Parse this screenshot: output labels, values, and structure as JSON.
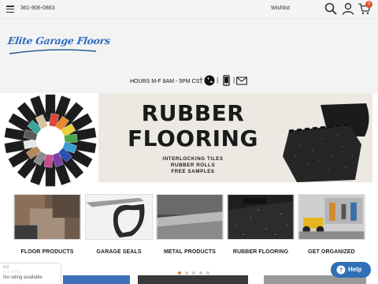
{
  "topbar": {
    "phone": "361-906-0863",
    "wishlist": "Wishlist",
    "cart_count": "0"
  },
  "header": {
    "logo_text": "Elite Garage Floors",
    "hours": "HOURS M-F 8AM - 5PM CST",
    "separator": "|"
  },
  "hero": {
    "title_line1": "RUBBER",
    "title_line2": "FLOORING",
    "sub1": "INTERLOCKING TILES",
    "sub2": "RUBBER ROLLS",
    "sub3": "FREE SAMPLES",
    "slides": 5,
    "active_slide": 1
  },
  "categories": [
    {
      "label": "FLOOR PRODUCTS"
    },
    {
      "label": "GARAGE SEALS"
    },
    {
      "label": "METAL PRODUCTS"
    },
    {
      "label": "RUBBER FLOORING"
    },
    {
      "label": "GET ORGANIZED"
    }
  ],
  "widgets": {
    "reviews_text": "No rating available",
    "reviews_score": "0.0",
    "help_label": "Help"
  },
  "colors": {
    "brand_blue": "#2a6cc0",
    "accent_orange": "#e27a27",
    "help_blue": "#2f6fb5",
    "badge_red": "#e0522c"
  }
}
